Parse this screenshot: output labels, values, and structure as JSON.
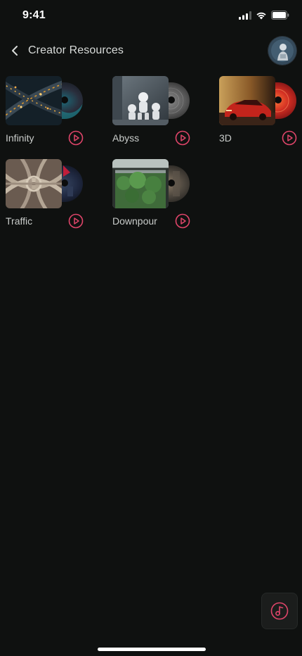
{
  "status_bar": {
    "time": "9:41"
  },
  "header": {
    "back_icon": "chevron-left-icon",
    "title": "Creator Resources",
    "avatar_icon": "profile-avatar"
  },
  "colors": {
    "background": "#0f1110",
    "accent": "#e0456a",
    "text": "#d9dcda"
  },
  "resources": [
    {
      "title": "Infinity",
      "play_icon": "play-circle-icon"
    },
    {
      "title": "Abyss",
      "play_icon": "play-circle-icon"
    },
    {
      "title": "3D",
      "play_icon": "play-circle-icon"
    },
    {
      "title": "Traffic",
      "play_icon": "play-circle-icon"
    },
    {
      "title": "Downpour",
      "play_icon": "play-circle-icon"
    }
  ],
  "floating_button": {
    "icon": "music-note-icon"
  }
}
